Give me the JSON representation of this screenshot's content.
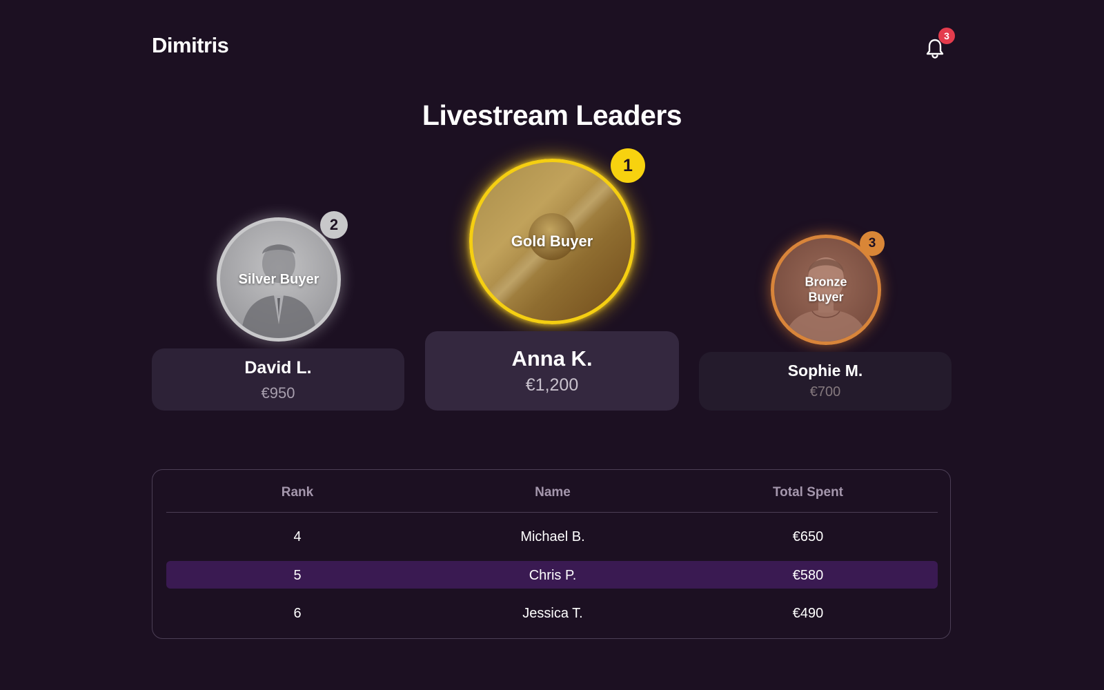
{
  "header": {
    "brand": "Dimitris",
    "notifications": {
      "icon": "bell-icon",
      "count": "3",
      "badge_color": "#e43c4d"
    }
  },
  "page_title": "Livestream Leaders",
  "podium": {
    "first": {
      "rank": "1",
      "tier": "Gold Buyer",
      "name": "Anna K.",
      "amount": "€1,200",
      "accent": "#f5cf12"
    },
    "second": {
      "rank": "2",
      "tier": "Silver Buyer",
      "name": "David L.",
      "amount": "€950",
      "accent": "#c9c9cb"
    },
    "third": {
      "rank": "3",
      "tier": "Bronze Buyer",
      "name": "Sophie M.",
      "amount": "€700",
      "accent": "#d9853a"
    }
  },
  "table": {
    "columns": [
      "Rank",
      "Name",
      "Total Spent"
    ],
    "rows": [
      {
        "rank": "4",
        "name": "Michael B.",
        "spent": "€650",
        "highlighted": false
      },
      {
        "rank": "5",
        "name": "Chris P.",
        "spent": "€580",
        "highlighted": true
      },
      {
        "rank": "6",
        "name": "Jessica T.",
        "spent": "€490",
        "highlighted": false
      }
    ],
    "highlight_color": "#3a1a52"
  },
  "theme": {
    "background": "#1c1022",
    "border": "#4c3f56"
  }
}
